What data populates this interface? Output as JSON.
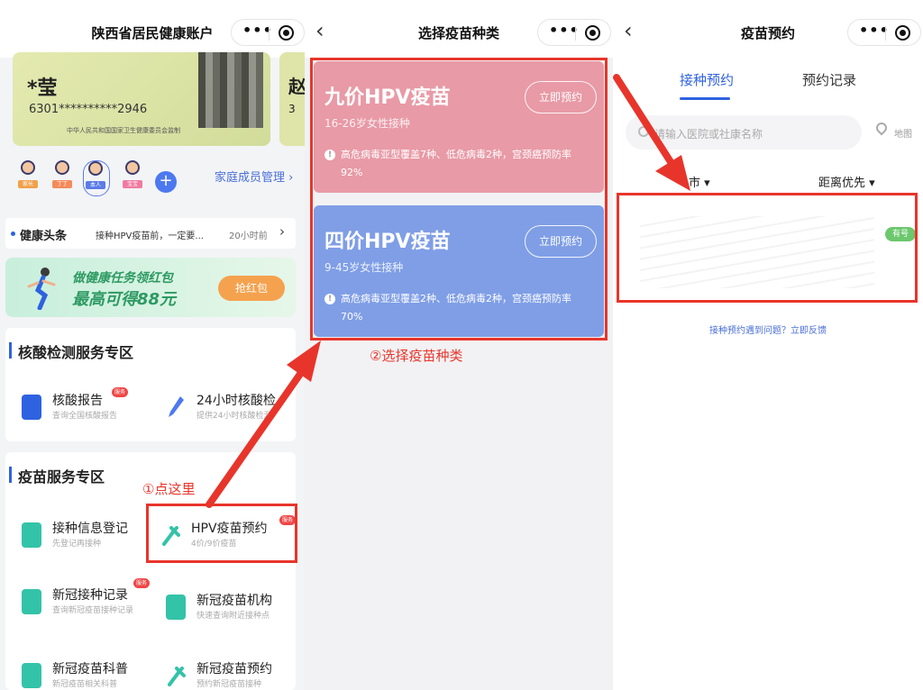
{
  "panel1": {
    "title": "陕西省居民健康账户",
    "card": {
      "name": "*莹",
      "number": "6301**********2946",
      "issuer": "中华人民共和国国家卫生健康委员会监制",
      "peek_name": "赵",
      "peek_num": "3"
    },
    "family": [
      {
        "label": "家长",
        "color": "#f0a24a"
      },
      {
        "label": "丁丁",
        "color": "#f58a5a"
      },
      {
        "label": "本人",
        "color": "#5b7be8"
      },
      {
        "label": "宝宝",
        "color": "#f07aa0"
      }
    ],
    "family_link": "家庭成员管理 ›",
    "news": {
      "label": "健康头条",
      "text": "接种HPV疫苗前，一定要...",
      "time": "20小时前",
      "arrow": "›"
    },
    "banner": {
      "line1": "做健康任务领红包",
      "line2": "最高可得88元",
      "button": "抢红包"
    },
    "sec_nucleic": {
      "title": "核酸检测服务专区",
      "items": [
        {
          "name": "核酸报告",
          "sub": "查询全国核酸报告",
          "color": "#2e62e0",
          "badge": "服务"
        },
        {
          "name": "24小时核酸检",
          "sub": "提供24小时核酸检测",
          "color": "#4d79f0"
        }
      ]
    },
    "sec_vaccine": {
      "title": "疫苗服务专区",
      "items": [
        {
          "name": "接种信息登记",
          "sub": "先登记再接种",
          "color": "#33c3a8"
        },
        {
          "name": "HPV疫苗预约",
          "sub": "4价/9价疫苗",
          "color": "#33c3a8",
          "badge": "服务"
        },
        {
          "name": "新冠接种记录",
          "sub": "查询新冠疫苗接种记录",
          "color": "#33c3a8",
          "badge": "服务"
        },
        {
          "name": "新冠疫苗机构",
          "sub": "快速查询附近接种点",
          "color": "#33c3a8"
        },
        {
          "name": "新冠疫苗科普",
          "sub": "新冠疫苗相关科普",
          "color": "#33c3a8"
        },
        {
          "name": "新冠疫苗预约",
          "sub": "预约新冠疫苗接种",
          "color": "#33c3a8"
        }
      ]
    },
    "annotation": "①点这里"
  },
  "panel2": {
    "title": "选择疫苗种类",
    "back": "‹",
    "vaccines": [
      {
        "title": "九价HPV疫苗",
        "sub": "16-26岁女性接种",
        "desc": "高危病毒亚型覆盖7种、低危病毒2种，宫颈癌预防率92%",
        "button": "立即预约",
        "color": "#e89aa6"
      },
      {
        "title": "四价HPV疫苗",
        "sub": "9-45岁女性接种",
        "desc": "高危病毒亚型覆盖2种、低危病毒2种，宫颈癌预防率70%",
        "button": "立即预约",
        "color": "#7f9ee6"
      }
    ],
    "annotation": "②选择疫苗种类"
  },
  "panel3": {
    "title": "疫苗预约",
    "back": "‹",
    "tabs": [
      "接种预约",
      "预约记录"
    ],
    "search_placeholder": "请输入医院或社康名称",
    "map_label": "地图",
    "filter_city": "市 ▾",
    "filter_sort": "距离优先 ▾",
    "result_tag": "有号",
    "feedback": "接种预约遇到问题？立即反馈"
  },
  "capsule": {
    "dots": "•••"
  }
}
